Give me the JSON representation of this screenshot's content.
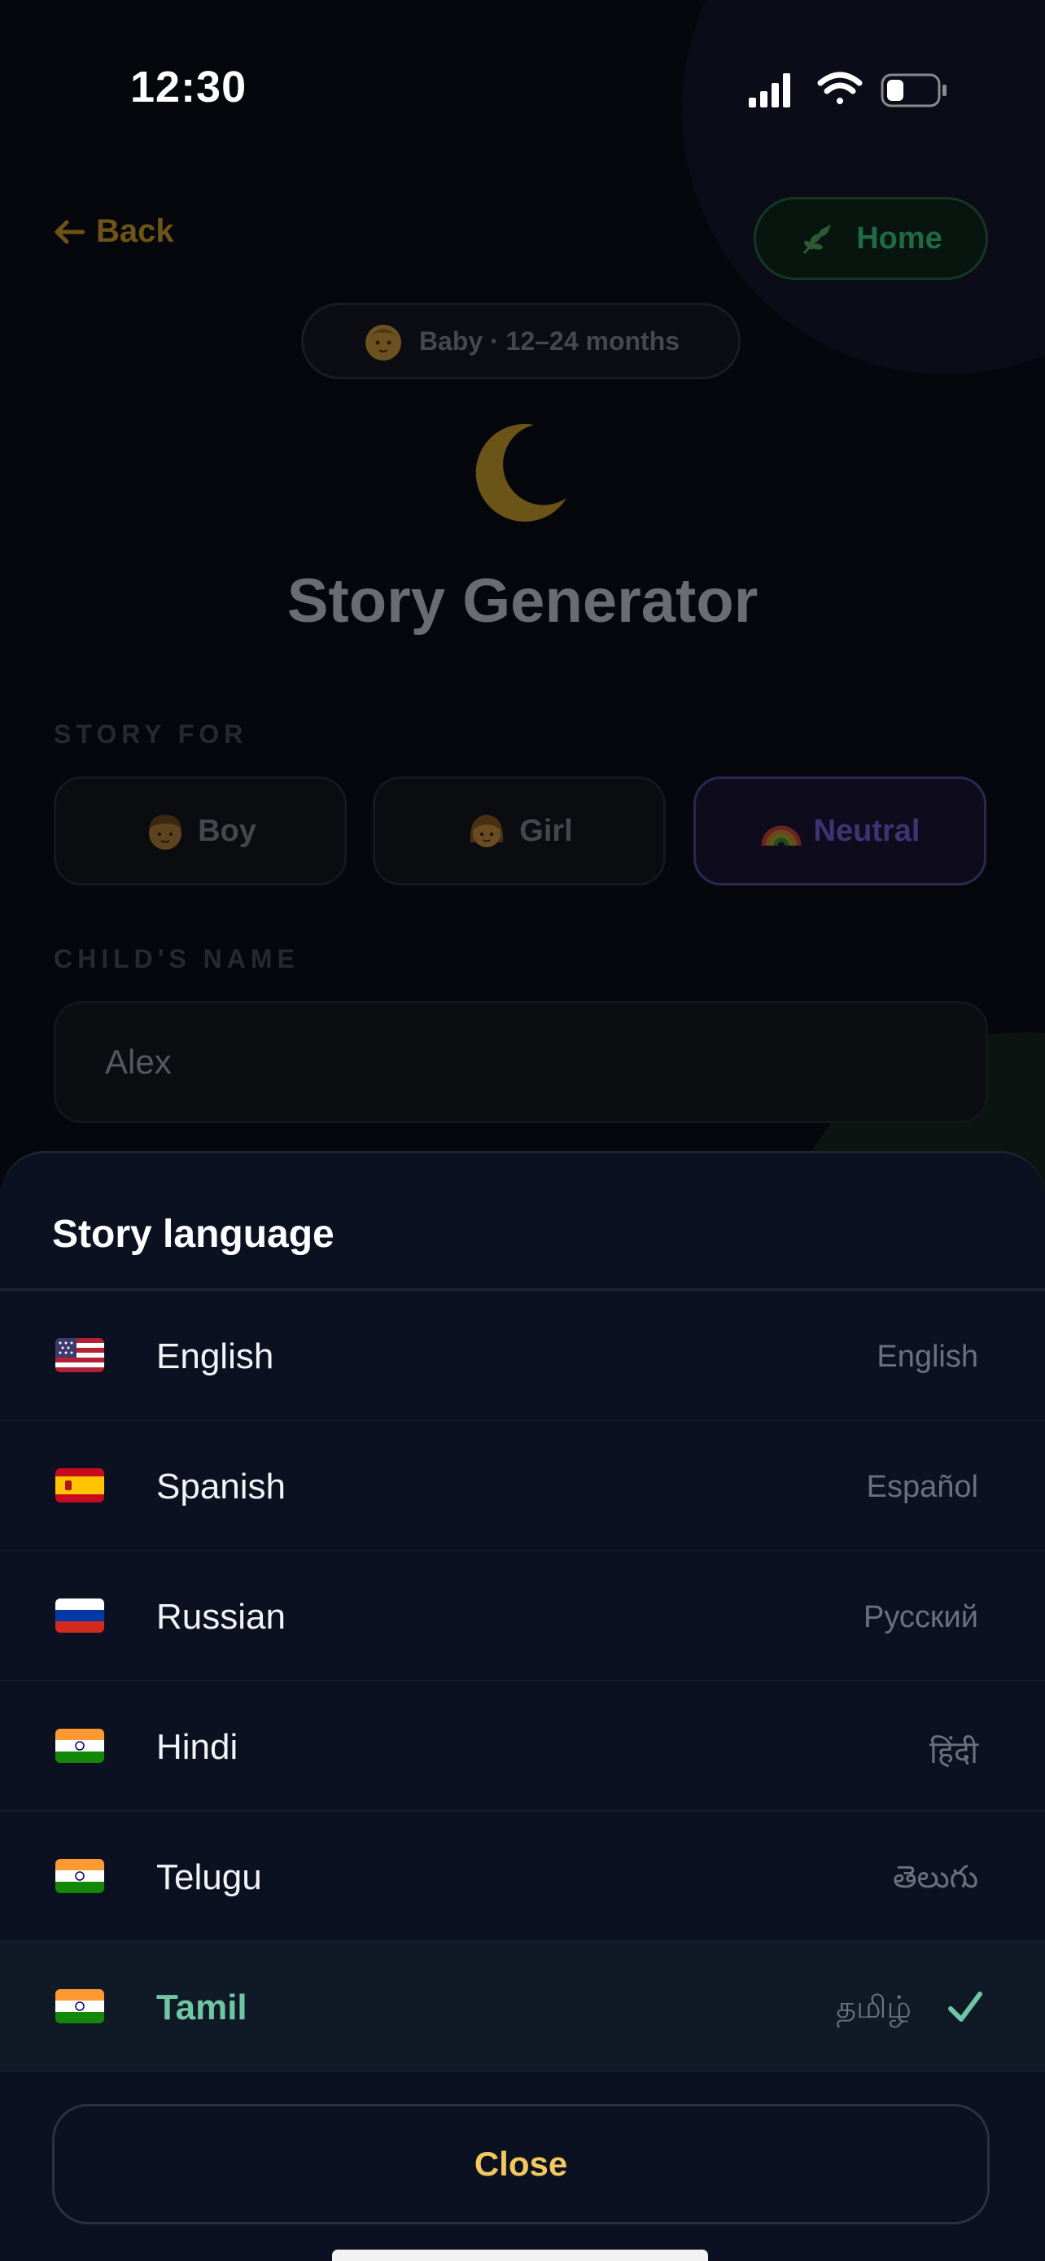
{
  "status_bar": {
    "time": "12:30",
    "icons": [
      "cellular-signal-icon",
      "wifi-icon",
      "battery-icon"
    ]
  },
  "nav": {
    "back_label": "Back",
    "home_label": "Home",
    "back_icon": "arrow-left-icon",
    "home_icon": "leaf-icon"
  },
  "age_pill": {
    "label": "Baby · 12–24 months",
    "icon": "baby-face-icon"
  },
  "hero": {
    "icon": "crescent-moon-icon",
    "title": "Story Generator"
  },
  "story_for": {
    "label": "STORY FOR",
    "options": [
      {
        "label": "Boy",
        "icon": "boy-face-icon",
        "selected": false
      },
      {
        "label": "Girl",
        "icon": "girl-face-icon",
        "selected": false
      },
      {
        "label": "Neutral",
        "icon": "rainbow-icon",
        "selected": true
      }
    ]
  },
  "child_name": {
    "label": "CHILD'S NAME",
    "value": "Alex"
  },
  "language_sheet": {
    "title": "Story language",
    "languages": [
      {
        "name": "English",
        "native": "English",
        "flag": "us-flag-icon",
        "selected": false
      },
      {
        "name": "Spanish",
        "native": "Español",
        "flag": "spain-flag-icon",
        "selected": false
      },
      {
        "name": "Russian",
        "native": "Русский",
        "flag": "russia-flag-icon",
        "selected": false
      },
      {
        "name": "Hindi",
        "native": "हिंदी",
        "flag": "india-flag-icon",
        "selected": false
      },
      {
        "name": "Telugu",
        "native": "తెలుగు",
        "flag": "india-flag-icon",
        "selected": false
      },
      {
        "name": "Tamil",
        "native": "தமிழ்",
        "flag": "india-flag-icon",
        "selected": true
      }
    ],
    "close_label": "Close"
  },
  "colors": {
    "accent_gold": "#f1c95f",
    "selected_green": "#6fc5a4",
    "sheet_bg": "#0b1120"
  }
}
